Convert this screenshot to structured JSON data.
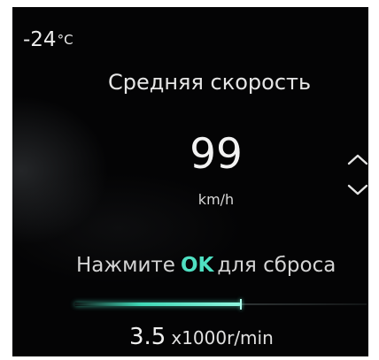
{
  "temperature": {
    "value": "-24",
    "unit": "°C"
  },
  "panel": {
    "title": "Средняя скорость",
    "speed_value": "99",
    "speed_unit": "km/h"
  },
  "controls": {
    "up_icon": "chevron-up-icon",
    "down_icon": "chevron-down-icon"
  },
  "hint": {
    "before": "Нажмите",
    "ok": "OK",
    "after": "для сброса"
  },
  "rpm": {
    "value": "3.5",
    "unit": "x1000r/min",
    "level_fraction": 0.57
  },
  "colors": {
    "accent": "#4fe0c2",
    "background": "#040405"
  }
}
